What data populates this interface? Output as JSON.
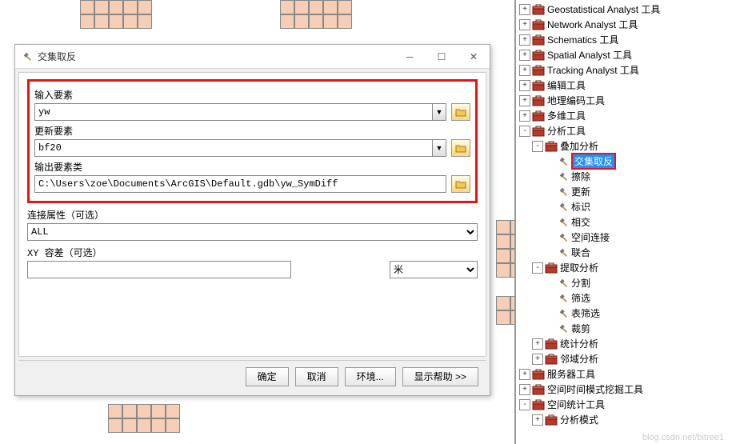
{
  "dialog": {
    "title": "交集取反",
    "input_features_label": "输入要素",
    "input_features_value": "yw",
    "update_features_label": "更新要素",
    "update_features_value": "bf20",
    "output_class_label": "输出要素类",
    "output_class_value": "C:\\Users\\zoe\\Documents\\ArcGIS\\Default.gdb\\yw_SymDiff",
    "join_attr_label": "连接属性（可选）",
    "join_attr_value": "ALL",
    "xy_tol_label": "XY 容差（可选）",
    "xy_unit": "米",
    "buttons": {
      "ok": "确定",
      "cancel": "取消",
      "env": "环境...",
      "help": "显示帮助 >>"
    }
  },
  "tree": {
    "items": [
      {
        "d": 0,
        "t": "tb",
        "e": "+",
        "l": "Geostatistical Analyst 工具"
      },
      {
        "d": 0,
        "t": "tb",
        "e": "+",
        "l": "Network Analyst 工具"
      },
      {
        "d": 0,
        "t": "tb",
        "e": "+",
        "l": "Schematics 工具"
      },
      {
        "d": 0,
        "t": "tb",
        "e": "+",
        "l": "Spatial Analyst 工具"
      },
      {
        "d": 0,
        "t": "tb",
        "e": "+",
        "l": "Tracking Analyst 工具"
      },
      {
        "d": 0,
        "t": "tb",
        "e": "+",
        "l": "编辑工具"
      },
      {
        "d": 0,
        "t": "tb",
        "e": "+",
        "l": "地理编码工具"
      },
      {
        "d": 0,
        "t": "tb",
        "e": "+",
        "l": "多维工具"
      },
      {
        "d": 0,
        "t": "tb",
        "e": "-",
        "l": "分析工具"
      },
      {
        "d": 1,
        "t": "ts",
        "e": "-",
        "l": "叠加分析"
      },
      {
        "d": 2,
        "t": "tool",
        "sel": true,
        "l": "交集取反"
      },
      {
        "d": 2,
        "t": "tool",
        "l": "擦除"
      },
      {
        "d": 2,
        "t": "tool",
        "l": "更新"
      },
      {
        "d": 2,
        "t": "tool",
        "l": "标识"
      },
      {
        "d": 2,
        "t": "tool",
        "l": "相交"
      },
      {
        "d": 2,
        "t": "tool",
        "l": "空间连接"
      },
      {
        "d": 2,
        "t": "tool",
        "l": "联合"
      },
      {
        "d": 1,
        "t": "ts",
        "e": "-",
        "l": "提取分析"
      },
      {
        "d": 2,
        "t": "tool",
        "l": "分割"
      },
      {
        "d": 2,
        "t": "tool",
        "l": "筛选"
      },
      {
        "d": 2,
        "t": "tool",
        "l": "表筛选"
      },
      {
        "d": 2,
        "t": "tool",
        "l": "裁剪"
      },
      {
        "d": 1,
        "t": "ts",
        "e": "+",
        "l": "统计分析"
      },
      {
        "d": 1,
        "t": "ts",
        "e": "+",
        "l": "邻域分析"
      },
      {
        "d": 0,
        "t": "tb",
        "e": "+",
        "l": "服务器工具"
      },
      {
        "d": 0,
        "t": "tb",
        "e": "+",
        "l": "空间时间模式挖掘工具"
      },
      {
        "d": 0,
        "t": "tb",
        "e": "-",
        "l": "空间统计工具"
      },
      {
        "d": 1,
        "t": "ts",
        "e": "+",
        "l": "分析模式"
      }
    ]
  },
  "watermark": "blog.csdn.net/bitree1"
}
